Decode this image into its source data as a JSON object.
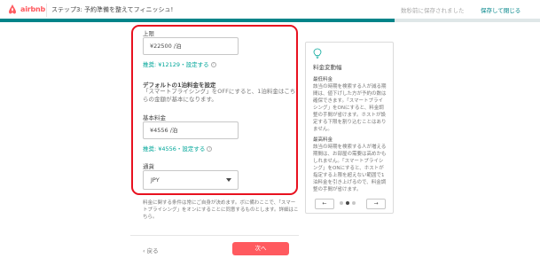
{
  "header": {
    "logo_text": "airbnb",
    "step_title": "ステップ3: 予約準備を整えてフィニッシュ!",
    "save_status": "数秒前に保存されました",
    "save_exit": "保存して閉じる",
    "progress_percent": 73,
    "brand_color": "#ff5a5f",
    "accent_color": "#008489"
  },
  "form": {
    "max_price_label": "上限",
    "max_price_value": "¥22500 /泊",
    "max_price_hint": "推奨: ¥12129・設定する",
    "default_price_title": "デフォルトの1泊料金を設定",
    "default_price_desc": "「スマートプライシング」をOFFにすると、1泊料金はこちらの金額が基本になります。",
    "base_price_label": "基本料金",
    "base_price_value": "¥4556 /泊",
    "base_price_hint": "推奨: ¥4556・設定する",
    "currency_label": "通貨",
    "currency_value": "JPY"
  },
  "footer": {
    "footnote": "料金に関する条件は常にご自身が決めます。ボに備わここで、「スマートプライシング」をオンにすることに同意するものとします。詳細はこちら。",
    "back_label": "‹ 戻る",
    "next_label": "次へ"
  },
  "tip_card": {
    "icon": "lightbulb-icon",
    "heading": "料金変動幅",
    "section1_title": "最低料金",
    "section1_text": "該当の時期を検索する人が減る期間は、値下げした方が予約の数は確保できます。「スマートプライシング」をONにすると、料金調整の手間が省けます。ホストが設定する下限を割り込むことはありません。",
    "section2_title": "最高料金",
    "section2_text": "該当の時期を検索する人が増える期間は、お部屋の需要は高めかもしれません。「スマートプライシング」をONにすると、ホストが指定する上限を超えない範囲で1泊料金を引き上げるので、料金調整の手間が省けます。",
    "prev_label": "←",
    "next_label": "→"
  }
}
